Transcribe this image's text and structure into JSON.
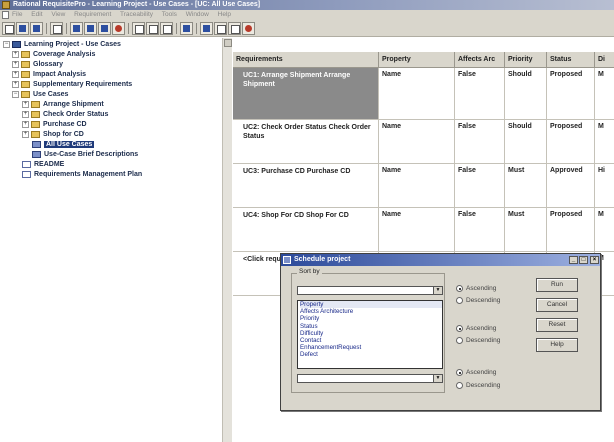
{
  "window": {
    "title": "Rational RequisitePro - Learning Project - Use Cases - [UC: All Use Cases]"
  },
  "menu": [
    "File",
    "Edit",
    "View",
    "Requirement",
    "Traceability",
    "Tools",
    "Window",
    "Help"
  ],
  "tree": {
    "root": "Learning Project - Use Cases",
    "items": [
      {
        "label": "Coverage Analysis",
        "icon": "folder-icon",
        "level": 1
      },
      {
        "label": "Glossary",
        "icon": "folder-icon",
        "level": 1
      },
      {
        "label": "Impact Analysis",
        "icon": "folder-icon",
        "level": 1
      },
      {
        "label": "Supplementary Requirements",
        "icon": "folder-icon",
        "level": 1
      },
      {
        "label": "Use Cases",
        "icon": "folder-icon",
        "level": 1
      },
      {
        "label": "Arrange Shipment",
        "icon": "folder-icon",
        "level": 2
      },
      {
        "label": "Check Order Status",
        "icon": "folder-icon",
        "level": 2
      },
      {
        "label": "Purchase CD",
        "icon": "folder-icon",
        "level": 2
      },
      {
        "label": "Shop for CD",
        "icon": "folder-icon",
        "level": 2
      },
      {
        "label": "All Use Cases",
        "icon": "view-icon",
        "level": 2
      },
      {
        "label": "Use-Case Brief Descriptions",
        "icon": "view-icon",
        "level": 2
      },
      {
        "label": "README",
        "icon": "document-icon",
        "level": 1
      },
      {
        "label": "Requirements Management Plan",
        "icon": "document-icon",
        "level": 1
      }
    ]
  },
  "grid": {
    "columns": [
      "Requirements",
      "Property",
      "Affects Arc",
      "Priority",
      "Status",
      "Di"
    ],
    "rows": [
      {
        "req": "UC1: Arrange Shipment Arrange Shipment",
        "property": "Name",
        "affects": "False",
        "priority": "Should",
        "status": "Proposed",
        "extra": "M"
      },
      {
        "req": "UC2: Check Order Status Check Order Status",
        "property": "Name",
        "affects": "False",
        "priority": "Should",
        "status": "Proposed",
        "extra": "M"
      },
      {
        "req": "UC3: Purchase CD Purchase CD",
        "property": "Name",
        "affects": "False",
        "priority": "Must",
        "status": "Approved",
        "extra": "Hi"
      },
      {
        "req": "UC4: Shop For CD Shop For CD",
        "property": "Name",
        "affects": "False",
        "priority": "Must",
        "status": "Proposed",
        "extra": "M"
      },
      {
        "req": "<Click require",
        "property": "",
        "affects": "",
        "priority": "",
        "status": "",
        "extra": "M"
      }
    ]
  },
  "dialog": {
    "title": "Schedule project",
    "sort_by_label": "Sort by",
    "dropdown_options": [
      "Property",
      "Affects Architecture",
      "Priority",
      "Status",
      "Difficulty",
      "Contact",
      "EnhancementRequest",
      "Defect"
    ],
    "ascending": "Ascending",
    "descending": "Descending",
    "buttons": {
      "run": "Run",
      "cancel": "Cancel",
      "reset": "Reset",
      "help": "Help"
    }
  }
}
